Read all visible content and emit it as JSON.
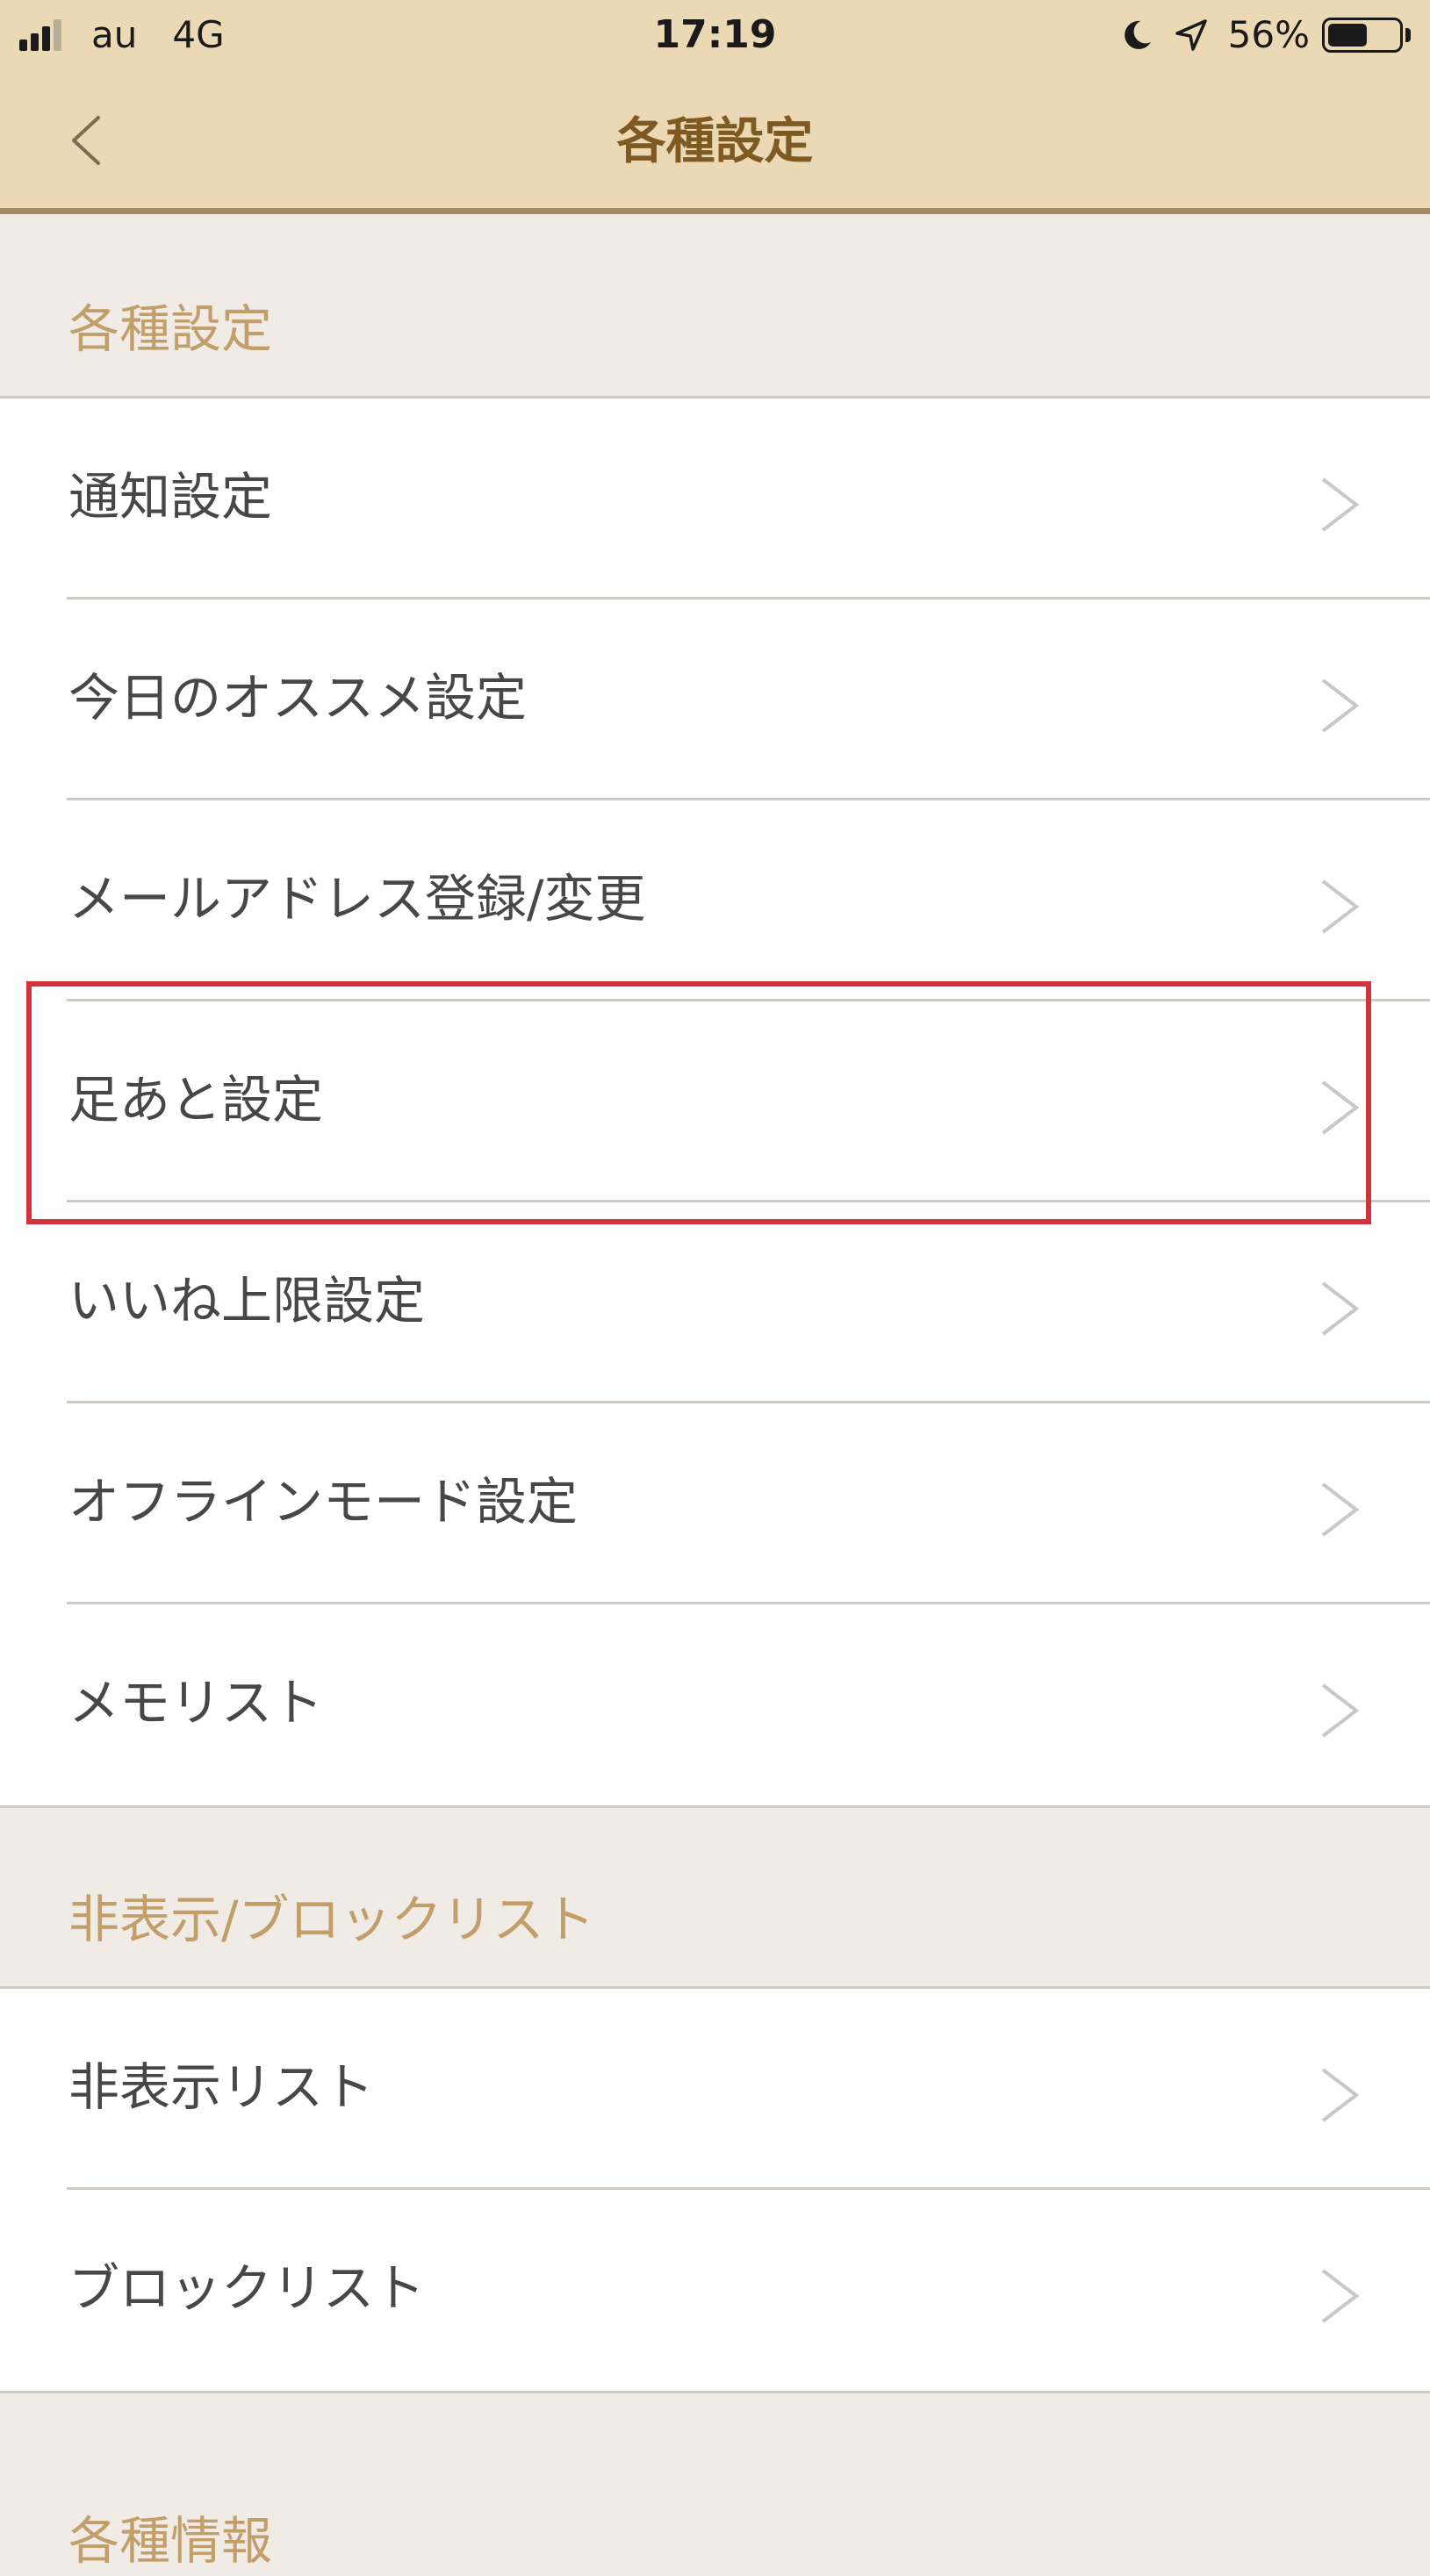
{
  "status_bar": {
    "carrier": "au",
    "network": "4G",
    "time": "17:19",
    "battery_percent": "56%",
    "battery_level": 0.56
  },
  "nav": {
    "back_icon": "chevron-left-icon",
    "title": "各種設定"
  },
  "sections": [
    {
      "title": "各種設定",
      "items": [
        {
          "label": "通知設定"
        },
        {
          "label": "今日のオススメ設定"
        },
        {
          "label": "メールアドレス登録/変更"
        },
        {
          "label": "足あと設定"
        },
        {
          "label": "いいね上限設定"
        },
        {
          "label": "オフラインモード設定"
        },
        {
          "label": "メモリスト"
        }
      ]
    },
    {
      "title": "非表示/ブロックリスト",
      "items": [
        {
          "label": "非表示リスト"
        },
        {
          "label": "ブロックリスト"
        }
      ]
    },
    {
      "title": "各種情報",
      "items": []
    }
  ],
  "colors": {
    "nav_background": "#ead9b4",
    "nav_title": "#7e5a22",
    "section_title": "#c29e6a",
    "highlight": "#d1323b"
  }
}
